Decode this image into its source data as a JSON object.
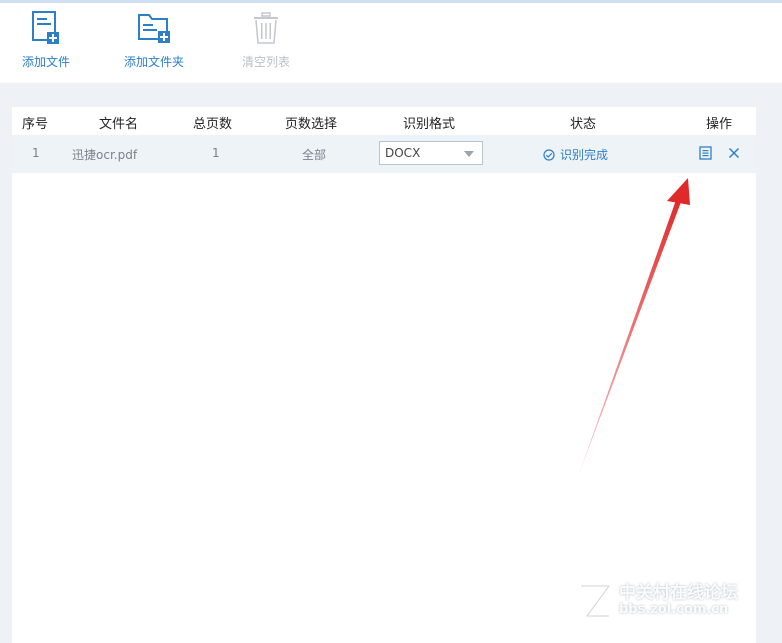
{
  "toolbar": {
    "add_file": "添加文件",
    "add_folder": "添加文件夹",
    "clear_list": "清空列表"
  },
  "table": {
    "headers": {
      "index": "序号",
      "filename": "文件名",
      "total_pages": "总页数",
      "page_select": "页数选择",
      "format": "识别格式",
      "status": "状态",
      "actions": "操作"
    },
    "rows": [
      {
        "index": "1",
        "filename": "迅捷ocr.pdf",
        "total_pages": "1",
        "page_select": "全部",
        "format": "DOCX",
        "status": "识别完成"
      }
    ]
  },
  "watermark": {
    "line1": "中关村在线论坛",
    "line2": "bbs.zol.com.cn"
  },
  "colors": {
    "accent": "#2d7fc7",
    "disabled": "#b9c0c8",
    "annotation_arrow": "#e02a2a"
  },
  "icons": [
    "add-file-icon",
    "add-folder-icon",
    "trash-icon",
    "check-circle-icon",
    "document-icon",
    "close-icon",
    "zol-logo-icon"
  ]
}
